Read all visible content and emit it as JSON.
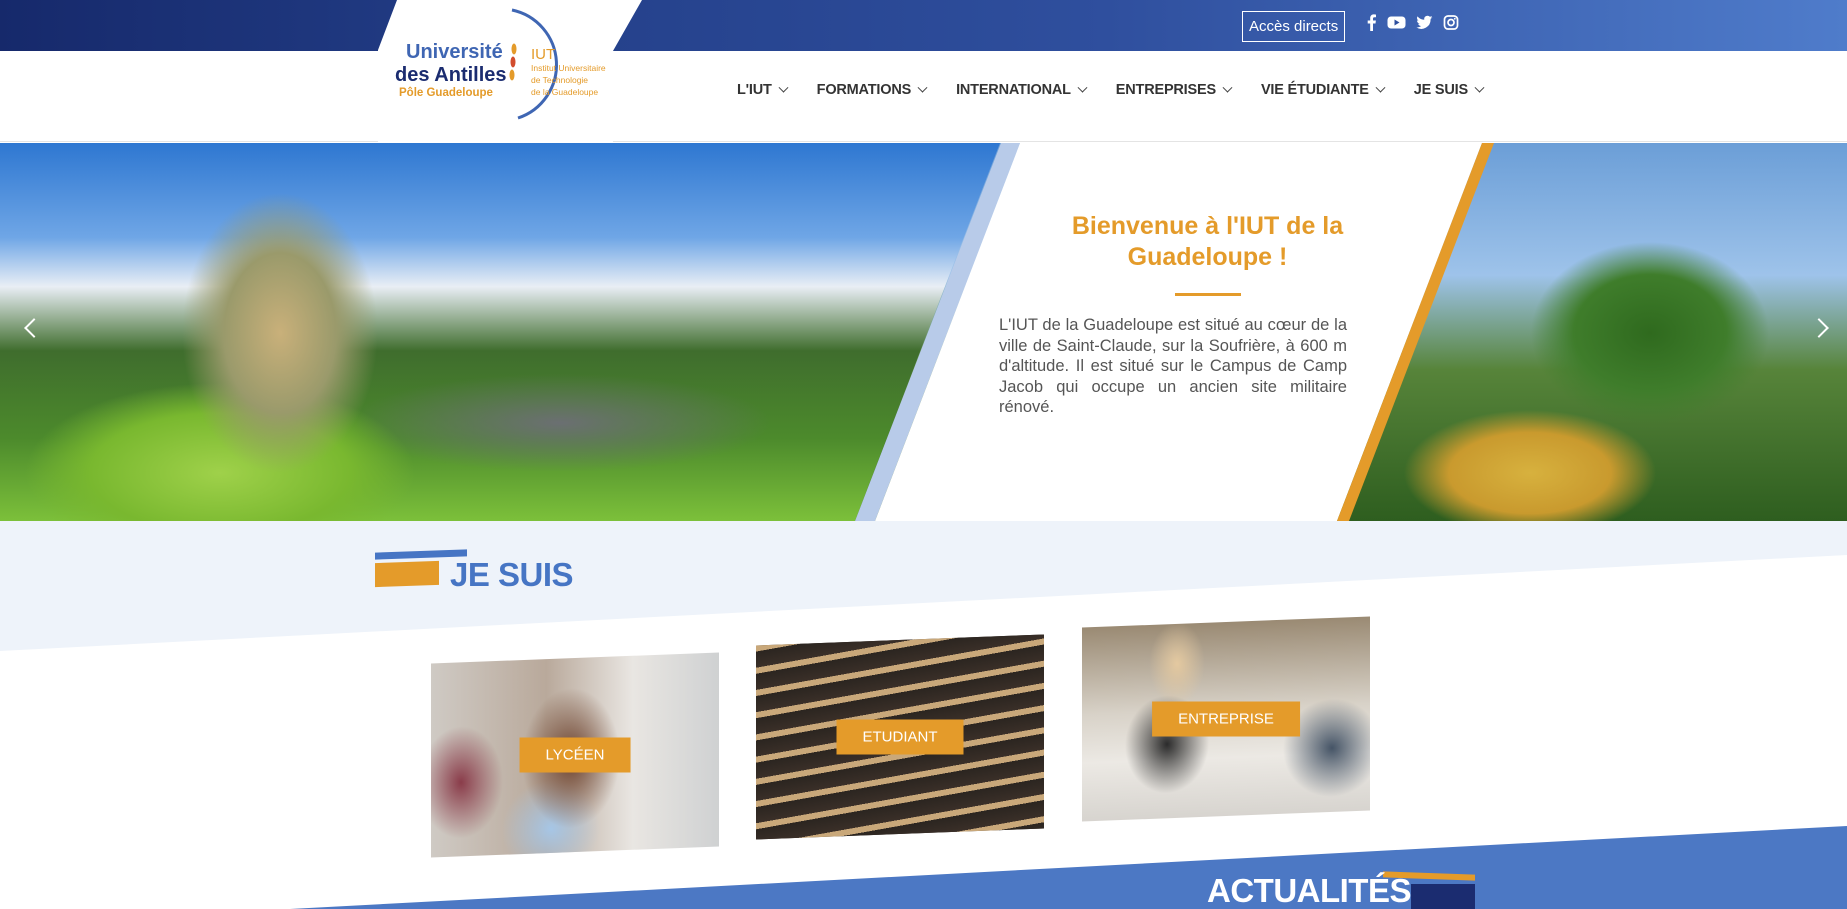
{
  "topbar": {
    "acces_label": "Accès directs",
    "socials": [
      "facebook-icon",
      "youtube-icon",
      "twitter-icon",
      "instagram-icon"
    ]
  },
  "logo": {
    "line1": "Université",
    "line2": "des Antilles",
    "line3": "Pôle Guadeloupe",
    "iut": "IUT",
    "iut_sub1": "Institut Universitaire",
    "iut_sub2": "de Technologie",
    "iut_sub3": "de la Guadeloupe"
  },
  "nav": {
    "items": [
      {
        "label": "L'IUT"
      },
      {
        "label": "FORMATIONS"
      },
      {
        "label": "INTERNATIONAL"
      },
      {
        "label": "ENTREPRISES"
      },
      {
        "label": "VIE ÉTUDIANTE"
      },
      {
        "label": "JE SUIS"
      }
    ]
  },
  "hero": {
    "title": "Bienvenue à l'IUT de la Guadeloupe !",
    "text": "L'IUT de la Guadeloupe est situé au cœur de la ville de Saint-Claude, sur la Soufrière, à 600 m d'altitude. Il est situé sur le Campus de Camp Jacob qui occupe un ancien site militaire rénové."
  },
  "je_suis": {
    "title": "JE SUIS",
    "cards": [
      {
        "label": "LYCÉEN"
      },
      {
        "label": "ETUDIANT"
      },
      {
        "label": "ENTREPRISE"
      }
    ]
  },
  "actualites": {
    "title": "ACTUALITÉS"
  },
  "colors": {
    "accent_gold": "#e49b2a",
    "brand_blue": "#4675c4",
    "navy": "#1b2c70"
  }
}
